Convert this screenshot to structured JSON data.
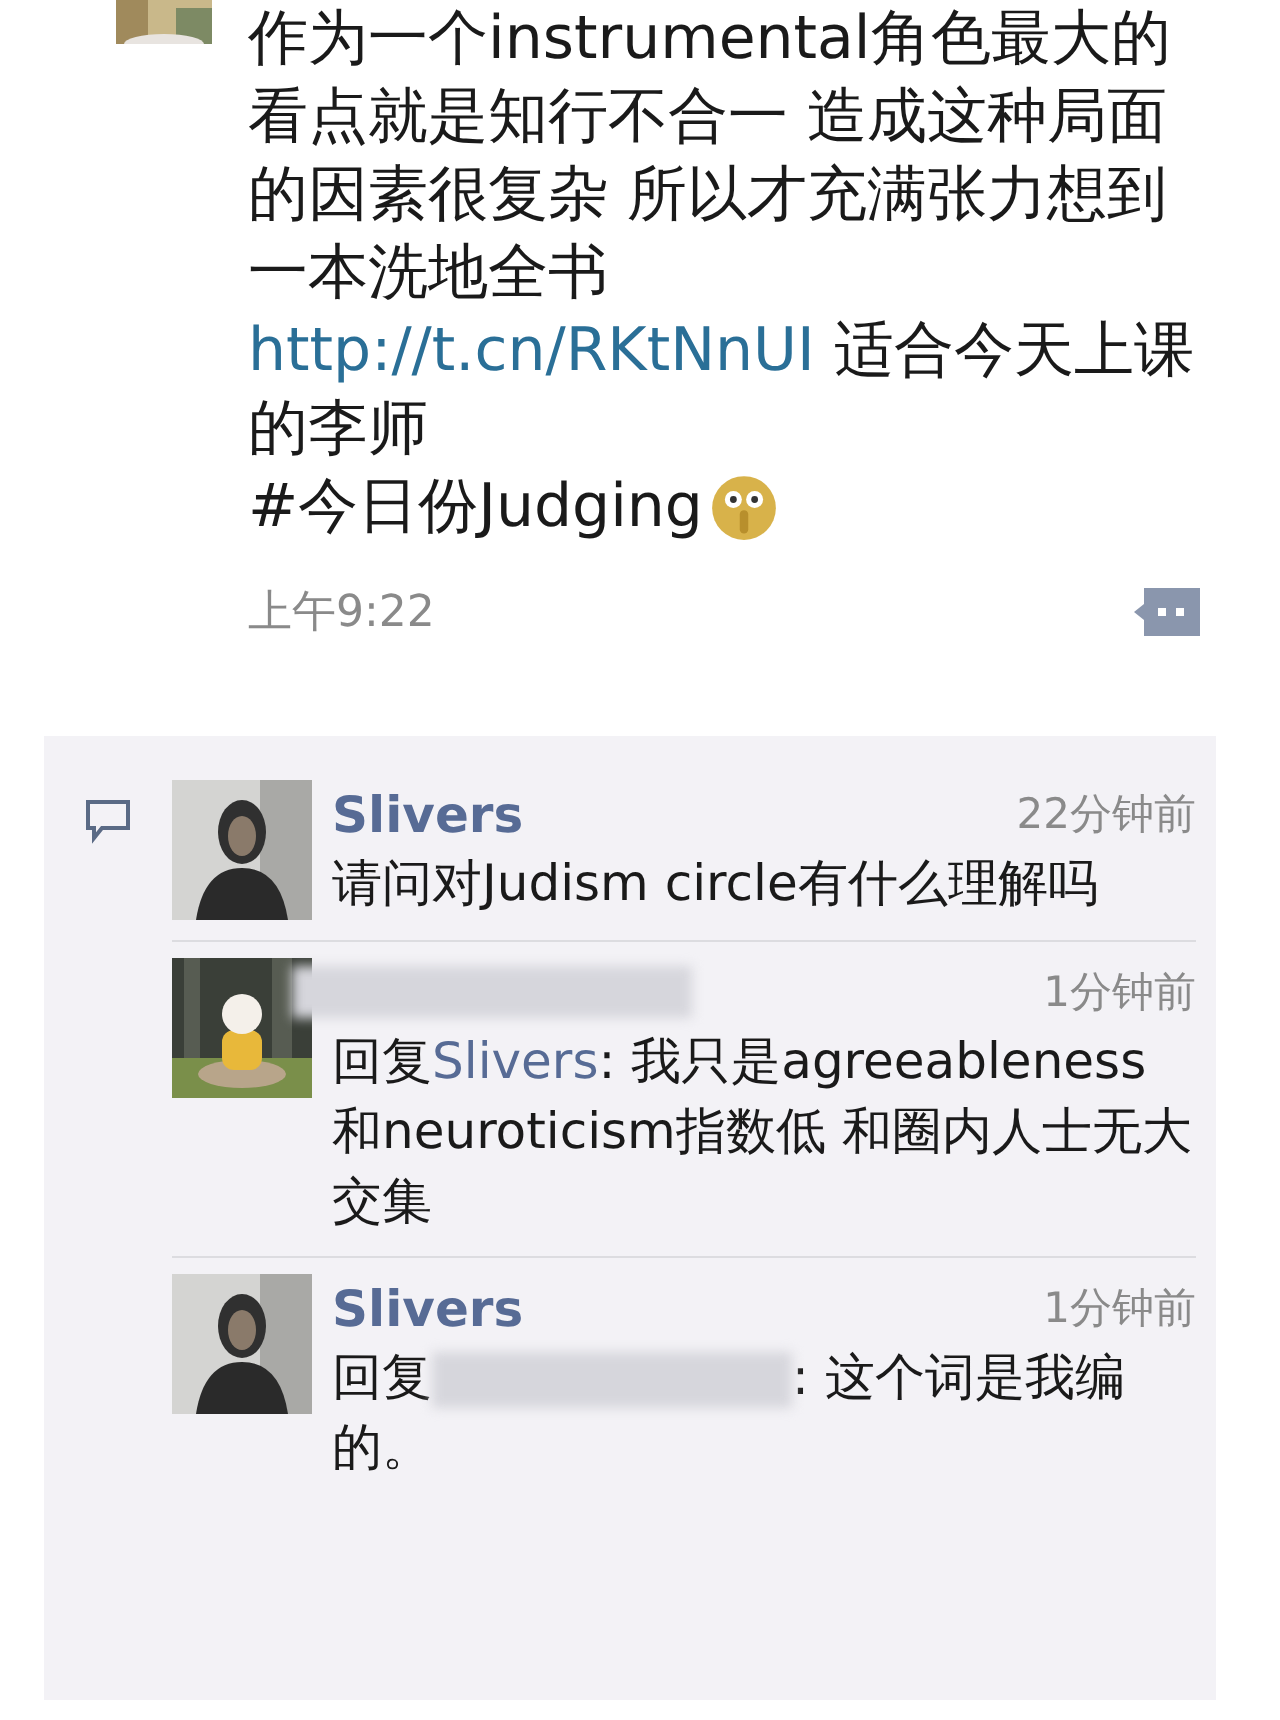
{
  "post": {
    "text_1": "作为一个instrumental角色最大的看点就是知行不合一 造成这种局面的因素很复杂 所以才充满张力想到一本洗地全书",
    "link": "http://t.cn/RKtNnUI",
    "text_2": " 适合今天上课的李师",
    "hashtag": "#今日份Judging",
    "time": "上午9:22"
  },
  "comments": [
    {
      "kind": "comment",
      "author": "Slivers",
      "author_redacted": false,
      "time": "22分钟前",
      "text": "请问对Judism circle有什么理解吗"
    },
    {
      "kind": "reply",
      "author_redacted": true,
      "time": "1分钟前",
      "reply_label": "回复",
      "reply_to": "Slivers",
      "reply_to_redacted": false,
      "text": ": 我只是agreeableness和neuroticism指数低 和圈内人士无大交集"
    },
    {
      "kind": "reply",
      "author": "Slivers",
      "author_redacted": false,
      "time": "1分钟前",
      "reply_label": "回复",
      "reply_to_redacted": true,
      "text": ": 这个词是我编的。"
    }
  ]
}
